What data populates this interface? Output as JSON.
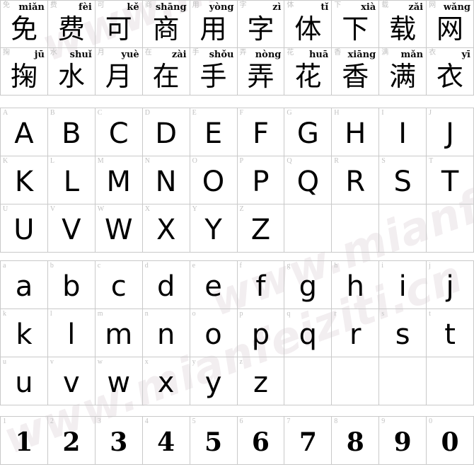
{
  "page": {
    "title": "Font specimen sheet",
    "background_color": "#ffffff",
    "grid_line_color": "#c9c9c9",
    "reference_label_color": "#c2c2c2",
    "glyph_color": "#000000",
    "watermark_color": "#f2eef0"
  },
  "watermarks": [
    {
      "text": "www.mianfeiziti.cn"
    },
    {
      "text": "www.mianfeiziti.cn"
    },
    {
      "text": "www.mianfeiziti.cn"
    }
  ],
  "cjk_section": {
    "rows": [
      [
        {
          "ref": "免",
          "pinyin": "miǎn",
          "glyph": "免"
        },
        {
          "ref": "费",
          "pinyin": "fèi",
          "glyph": "费"
        },
        {
          "ref": "可",
          "pinyin": "kě",
          "glyph": "可"
        },
        {
          "ref": "商",
          "pinyin": "shāng",
          "glyph": "商"
        },
        {
          "ref": "用",
          "pinyin": "yòng",
          "glyph": "用"
        },
        {
          "ref": "字",
          "pinyin": "zì",
          "glyph": "字"
        },
        {
          "ref": "体",
          "pinyin": "tǐ",
          "glyph": "体"
        },
        {
          "ref": "下",
          "pinyin": "xià",
          "glyph": "下"
        },
        {
          "ref": "载",
          "pinyin": "zǎi",
          "glyph": "载"
        },
        {
          "ref": "网",
          "pinyin": "wǎng",
          "glyph": "网"
        }
      ],
      [
        {
          "ref": "掬",
          "pinyin": "jū",
          "glyph": "掬"
        },
        {
          "ref": "水",
          "pinyin": "shuǐ",
          "glyph": "水"
        },
        {
          "ref": "月",
          "pinyin": "yuè",
          "glyph": "月"
        },
        {
          "ref": "在",
          "pinyin": "zài",
          "glyph": "在"
        },
        {
          "ref": "手",
          "pinyin": "shǒu",
          "glyph": "手"
        },
        {
          "ref": "弄",
          "pinyin": "nòng",
          "glyph": "弄"
        },
        {
          "ref": "花",
          "pinyin": "huā",
          "glyph": "花"
        },
        {
          "ref": "香",
          "pinyin": "xiāng",
          "glyph": "香"
        },
        {
          "ref": "满",
          "pinyin": "mǎn",
          "glyph": "满"
        },
        {
          "ref": "衣",
          "pinyin": "yī",
          "glyph": "衣"
        }
      ]
    ]
  },
  "uppercase_section": {
    "rows": [
      [
        {
          "ref": "A",
          "glyph": "A"
        },
        {
          "ref": "B",
          "glyph": "B"
        },
        {
          "ref": "C",
          "glyph": "C"
        },
        {
          "ref": "D",
          "glyph": "D"
        },
        {
          "ref": "E",
          "glyph": "E"
        },
        {
          "ref": "F",
          "glyph": "F"
        },
        {
          "ref": "G",
          "glyph": "G"
        },
        {
          "ref": "H",
          "glyph": "H"
        },
        {
          "ref": "I",
          "glyph": "I"
        },
        {
          "ref": "J",
          "glyph": "J"
        }
      ],
      [
        {
          "ref": "K",
          "glyph": "K"
        },
        {
          "ref": "L",
          "glyph": "L"
        },
        {
          "ref": "M",
          "glyph": "M"
        },
        {
          "ref": "N",
          "glyph": "N"
        },
        {
          "ref": "O",
          "glyph": "O"
        },
        {
          "ref": "P",
          "glyph": "P"
        },
        {
          "ref": "Q",
          "glyph": "Q"
        },
        {
          "ref": "R",
          "glyph": "R"
        },
        {
          "ref": "S",
          "glyph": "S"
        },
        {
          "ref": "T",
          "glyph": "T"
        }
      ],
      [
        {
          "ref": "U",
          "glyph": "U"
        },
        {
          "ref": "V",
          "glyph": "V"
        },
        {
          "ref": "W",
          "glyph": "W"
        },
        {
          "ref": "X",
          "glyph": "X"
        },
        {
          "ref": "Y",
          "glyph": "Y"
        },
        {
          "ref": "Z",
          "glyph": "Z"
        },
        {
          "ref": "",
          "glyph": ""
        },
        {
          "ref": "",
          "glyph": ""
        },
        {
          "ref": "",
          "glyph": ""
        },
        {
          "ref": "",
          "glyph": ""
        }
      ]
    ]
  },
  "lowercase_section": {
    "rows": [
      [
        {
          "ref": "a",
          "glyph": "a"
        },
        {
          "ref": "b",
          "glyph": "b"
        },
        {
          "ref": "c",
          "glyph": "c"
        },
        {
          "ref": "d",
          "glyph": "d"
        },
        {
          "ref": "e",
          "glyph": "e"
        },
        {
          "ref": "f",
          "glyph": "f"
        },
        {
          "ref": "g",
          "glyph": "g"
        },
        {
          "ref": "h",
          "glyph": "h"
        },
        {
          "ref": "i",
          "glyph": "i"
        },
        {
          "ref": "j",
          "glyph": "j"
        }
      ],
      [
        {
          "ref": "k",
          "glyph": "k"
        },
        {
          "ref": "l",
          "glyph": "l"
        },
        {
          "ref": "m",
          "glyph": "m"
        },
        {
          "ref": "n",
          "glyph": "n"
        },
        {
          "ref": "o",
          "glyph": "o"
        },
        {
          "ref": "p",
          "glyph": "p"
        },
        {
          "ref": "q",
          "glyph": "q"
        },
        {
          "ref": "r",
          "glyph": "r"
        },
        {
          "ref": "s",
          "glyph": "s"
        },
        {
          "ref": "t",
          "glyph": "t"
        }
      ],
      [
        {
          "ref": "u",
          "glyph": "u"
        },
        {
          "ref": "v",
          "glyph": "v"
        },
        {
          "ref": "w",
          "glyph": "w"
        },
        {
          "ref": "x",
          "glyph": "x"
        },
        {
          "ref": "y",
          "glyph": "y"
        },
        {
          "ref": "z",
          "glyph": "z"
        },
        {
          "ref": "",
          "glyph": ""
        },
        {
          "ref": "",
          "glyph": ""
        },
        {
          "ref": "",
          "glyph": ""
        },
        {
          "ref": "",
          "glyph": ""
        }
      ]
    ]
  },
  "digits_section": {
    "rows": [
      [
        {
          "ref": "1",
          "glyph": "1"
        },
        {
          "ref": "2",
          "glyph": "2"
        },
        {
          "ref": "3",
          "glyph": "3"
        },
        {
          "ref": "4",
          "glyph": "4"
        },
        {
          "ref": "5",
          "glyph": "5"
        },
        {
          "ref": "6",
          "glyph": "6"
        },
        {
          "ref": "7",
          "glyph": "7"
        },
        {
          "ref": "8",
          "glyph": "8"
        },
        {
          "ref": "9",
          "glyph": "9"
        },
        {
          "ref": "0",
          "glyph": "0"
        }
      ]
    ]
  }
}
